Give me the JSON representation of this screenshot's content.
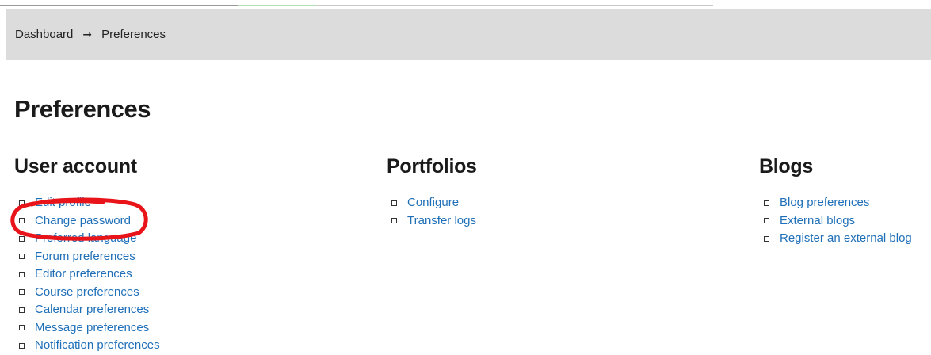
{
  "breadcrumb": {
    "items": [
      "Dashboard",
      "Preferences"
    ],
    "separator": "➞"
  },
  "page": {
    "title": "Preferences"
  },
  "sections": [
    {
      "heading": "User account",
      "links": [
        "Edit profile",
        "Change password",
        "Preferred language",
        "Forum preferences",
        "Editor preferences",
        "Course preferences",
        "Calendar preferences",
        "Message preferences",
        "Notification preferences"
      ]
    },
    {
      "heading": "Portfolios",
      "links": [
        "Configure",
        "Transfer logs"
      ]
    },
    {
      "heading": "Blogs",
      "links": [
        "Blog preferences",
        "External blogs",
        "Register an external blog"
      ]
    }
  ],
  "colors": {
    "link": "#1f6fb8",
    "annotation": "#e8141a",
    "breadcrumb_bg": "#dcdcdc"
  }
}
